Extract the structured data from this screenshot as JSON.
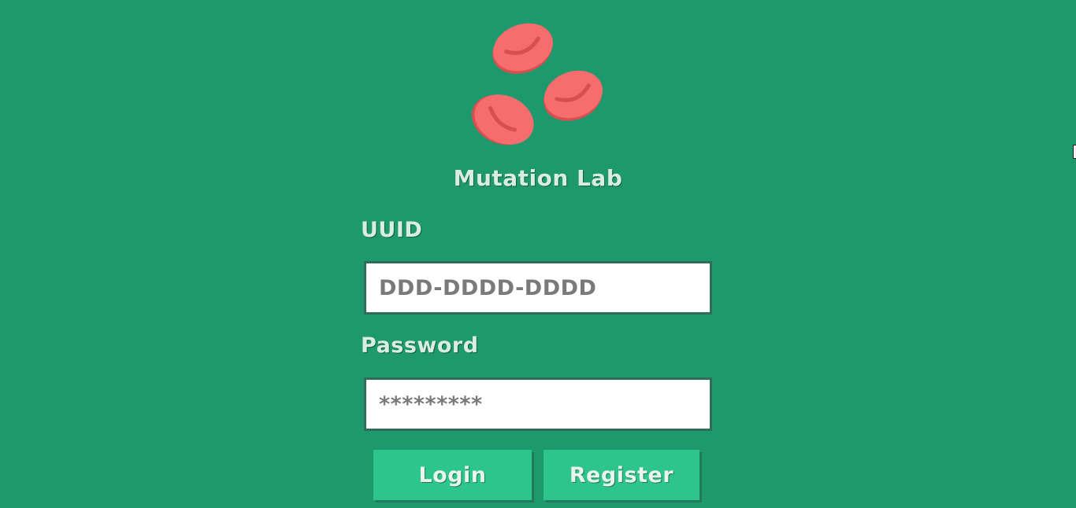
{
  "app": {
    "title": "Mutation Lab",
    "logo_icon": "blood-cells-icon"
  },
  "form": {
    "uuid_label": "UUID",
    "uuid_placeholder": "DDD-DDDD-DDDD",
    "password_label": "Password",
    "password_placeholder": "*********",
    "login_label": "Login",
    "register_label": "Register"
  },
  "colors": {
    "background": "#1e986d",
    "button": "#2ec58d",
    "cell": "#f76c6c",
    "label_text": "#d9ede4"
  }
}
